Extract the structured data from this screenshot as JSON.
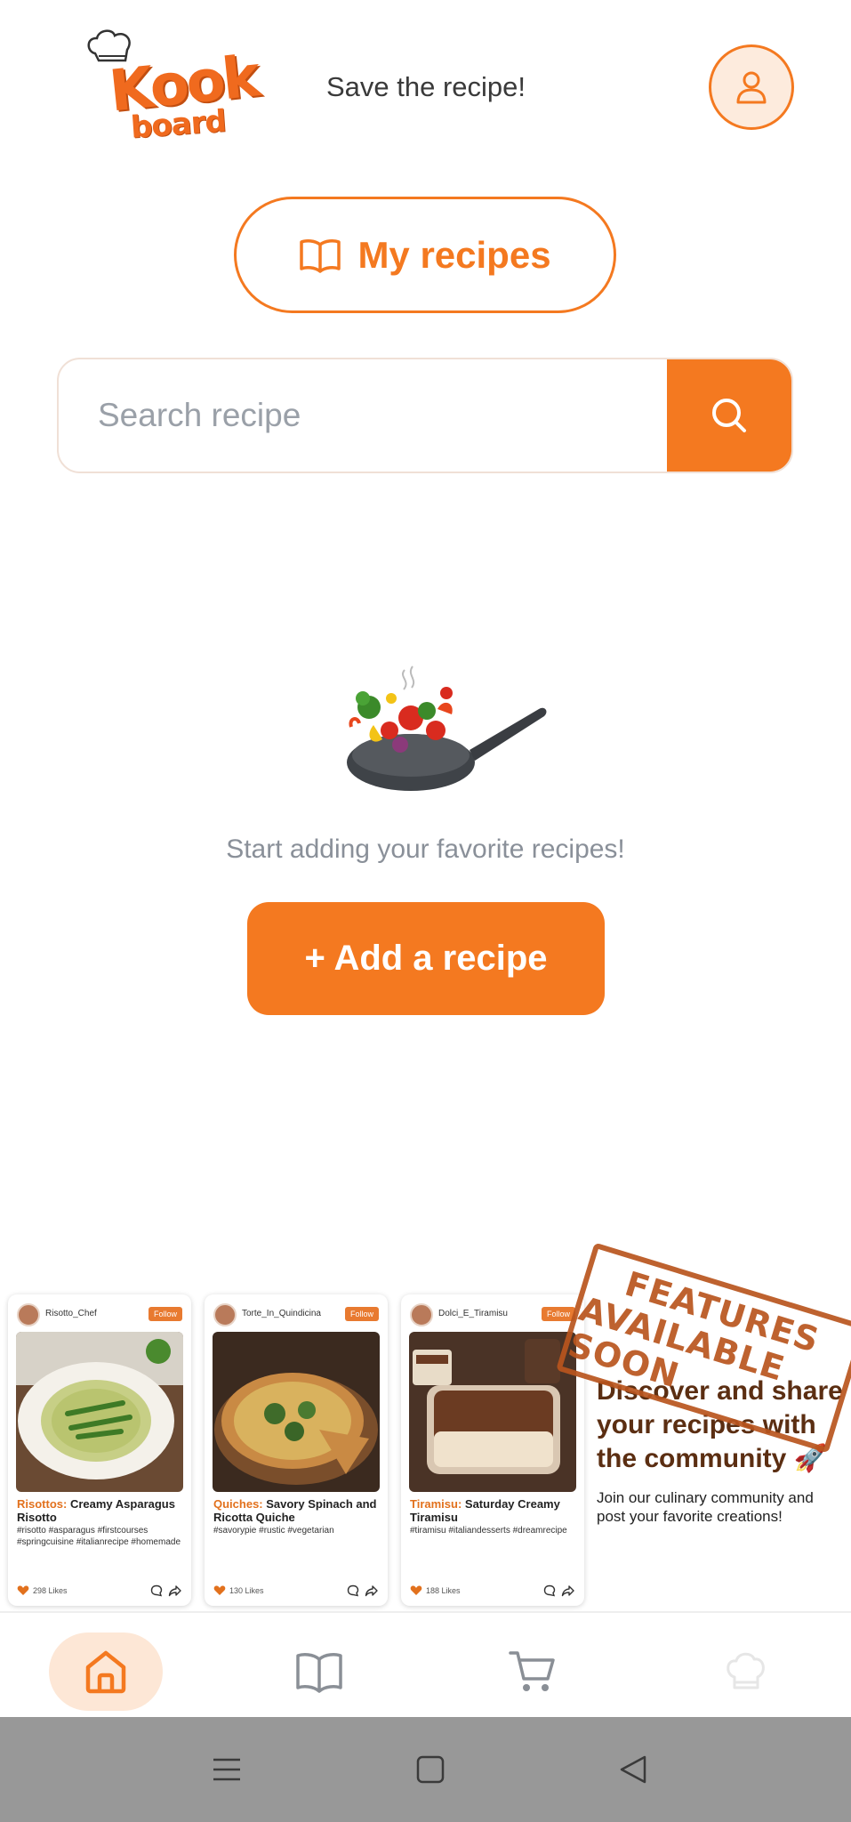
{
  "header": {
    "logo_top": "Kook",
    "logo_bottom": "board",
    "tagline": "Save the recipe!",
    "profile_icon": "user-icon"
  },
  "my_recipes": {
    "label": "My recipes",
    "icon": "book-icon"
  },
  "search": {
    "placeholder": "Search recipe",
    "value": "",
    "icon": "search-icon"
  },
  "empty_state": {
    "illustration": "frying-pan-vegetables",
    "message": "Start adding your favorite recipes!",
    "add_label": "+ Add a recipe"
  },
  "promo": {
    "stamp_line1": "FEATURES",
    "stamp_line2": "AVAILABLE SOON",
    "title": "Discover and share your recipes with the community 🚀",
    "subtitle": "Join our culinary community and post your favorite creations!",
    "cards": [
      {
        "user": "Risotto_Chef",
        "follow": "Follow",
        "category": "Risottos:",
        "title": " Creamy Asparagus Risotto",
        "tags": "#risotto #asparagus #firstcourses #springcuisine #italianrecipe #homemade",
        "likes": "298 Likes"
      },
      {
        "user": "Torte_In_Quindicina",
        "follow": "Follow",
        "category": "Quiches:",
        "title": " Savory Spinach and Ricotta Quiche",
        "tags": "#savorypie #rustic #vegetarian",
        "likes": "130 Likes"
      },
      {
        "user": "Dolci_E_Tiramisu",
        "follow": "Follow",
        "category": "Tiramisu:",
        "title": " Saturday Creamy Tiramisu",
        "tags": "#tiramisu #italiandesserts #dreamrecipe",
        "likes": "188 Likes"
      }
    ]
  },
  "bottom_nav": {
    "items": [
      {
        "icon": "home-icon",
        "active": true
      },
      {
        "icon": "book-icon",
        "active": false
      },
      {
        "icon": "cart-icon",
        "active": false
      },
      {
        "icon": "chef-hat-icon",
        "active": false
      }
    ]
  },
  "system_nav": {
    "icons": [
      "menu-icon",
      "home-square-icon",
      "back-icon"
    ]
  },
  "colors": {
    "accent": "#F47920",
    "accent_light": "#FDE7D6",
    "stamp": "#B9551E",
    "discover_text": "#5b2e12"
  }
}
